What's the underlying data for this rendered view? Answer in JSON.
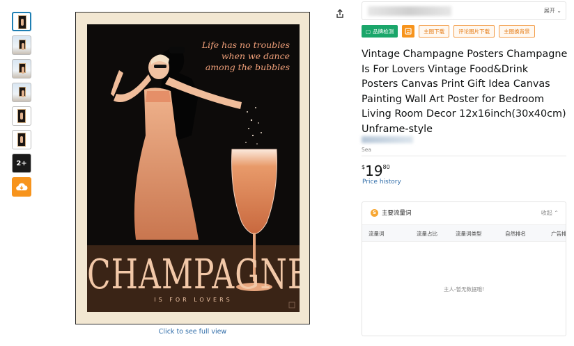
{
  "gallery": {
    "thumbnails": [
      {
        "kind": "poster",
        "active": true
      },
      {
        "kind": "scene"
      },
      {
        "kind": "scene"
      },
      {
        "kind": "scene"
      },
      {
        "kind": "poster"
      },
      {
        "kind": "poster"
      }
    ],
    "more_label": "2+",
    "full_view_link": "Click to see full view"
  },
  "poster": {
    "tagline_lines": [
      "Life has no troubles",
      "when we dance",
      "among the bubbles"
    ],
    "title": "CHAMPAGNE",
    "subtitle": "IS FOR LOVERS"
  },
  "toolbar": {
    "expand_label": "展开",
    "brand_check": "品牌检测",
    "download_main": "主图下载",
    "download_review": "评论图片下载",
    "main_bg_swap": "主图换背景"
  },
  "product": {
    "title": "Vintage Champagne Posters Champagne Is For Lovers Vintage Food&Drink Posters Canvas Print Gift Idea Canvas Painting Wall Art Poster for Bedroom Living Room Decor 12x16inch(30x40cm) Unframe-style",
    "store_fragment": "Sea",
    "price": {
      "currency": "$",
      "whole": "19",
      "fraction": "80"
    },
    "price_history": "Price history"
  },
  "keywords_panel": {
    "title": "主要流量词",
    "collapse_label": "收起",
    "columns": [
      "流量词",
      "流量占比",
      "流量词类型",
      "自然排名",
      "广告排名"
    ],
    "empty_text": "主人-暂无数据哦!"
  },
  "colors": {
    "link": "#2f6ca8",
    "accent_orange": "#f7941d",
    "brand_green": "#1aa66a"
  }
}
